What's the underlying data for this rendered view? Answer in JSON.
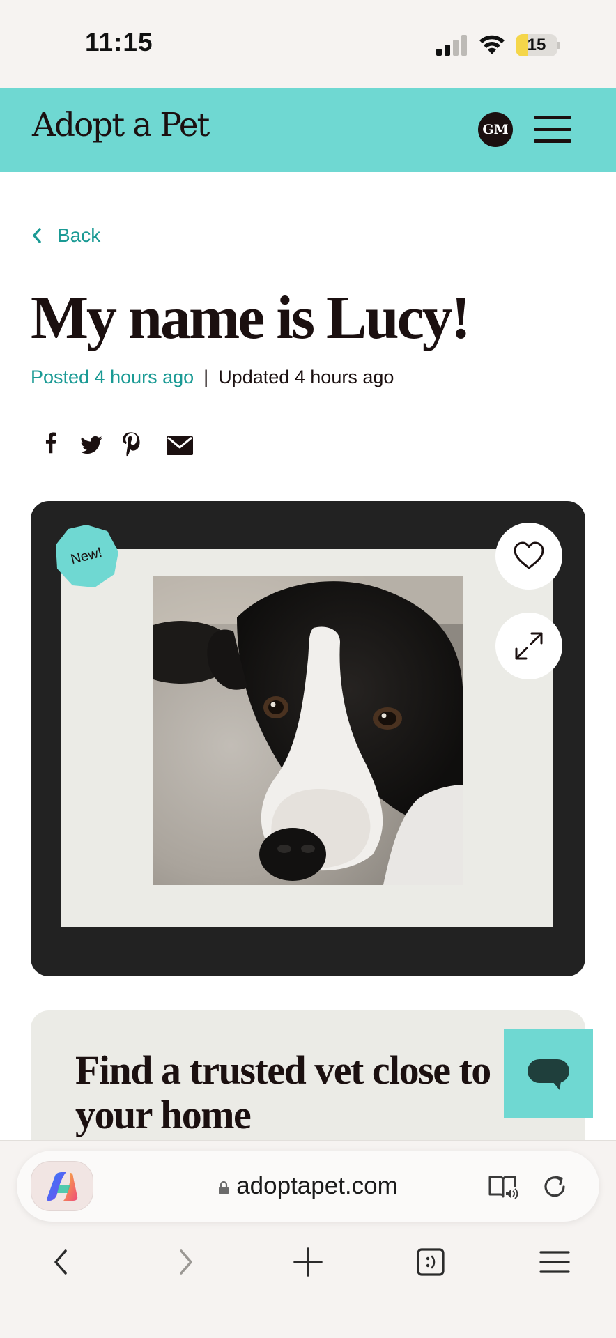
{
  "status_bar": {
    "time": "11:15",
    "battery_level": "15",
    "battery_fill_fraction": 0.15
  },
  "header": {
    "logo_text": "Adopt a Pet",
    "avatar_initials": "GM",
    "brand_color": "#6fd8d2",
    "menu_icon": "hamburger-menu-icon"
  },
  "page": {
    "back_label": "Back",
    "title": "My name is Lucy!",
    "posted": "Posted 4 hours ago",
    "separator": "|",
    "updated": "Updated 4 hours ago",
    "accent_color": "#1a9a94",
    "share_icons": [
      "facebook-icon",
      "twitter-icon",
      "pinterest-icon",
      "email-icon"
    ]
  },
  "photo_card": {
    "badge": "New!",
    "favorite_icon": "heart-icon",
    "expand_icon": "expand-icon",
    "photo_description_icon": "dog-photo"
  },
  "vet_card": {
    "title": "Find a trusted vet close to your home"
  },
  "chat": {
    "icon": "chat-bubble-icon"
  },
  "browser": {
    "url": "adoptapet.com",
    "icons": [
      "copilot-icon",
      "lock-icon",
      "reader-audio-icon",
      "reload-icon"
    ],
    "nav": [
      "back-arrow-icon",
      "forward-arrow-icon",
      "new-tab-icon",
      "tabs-icon",
      "browser-menu-icon"
    ]
  }
}
